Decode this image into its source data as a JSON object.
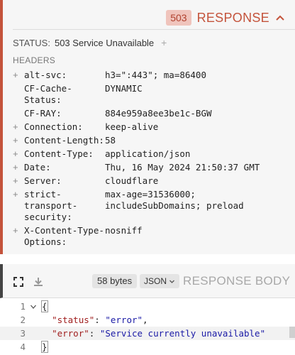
{
  "response": {
    "code": "503",
    "title": "RESPONSE",
    "status_label": "STATUS:",
    "status_value": "503 Service Unavailable",
    "headers_label": "HEADERS",
    "headers": [
      {
        "expandable": true,
        "name": "alt-svc:",
        "value": "h3=\":443\"; ma=86400"
      },
      {
        "expandable": false,
        "name": "CF-Cache-Status:",
        "value": "DYNAMIC"
      },
      {
        "expandable": false,
        "name": "CF-RAY:",
        "value": "884e959a8ee3be1c-BGW"
      },
      {
        "expandable": true,
        "name": "Connection:",
        "value": "keep-alive"
      },
      {
        "expandable": true,
        "name": "Content-Length:",
        "value": "58"
      },
      {
        "expandable": true,
        "name": "Content-Type:",
        "value": "application/json"
      },
      {
        "expandable": true,
        "name": "Date:",
        "value": "Thu, 16 May 2024 21:50:37 GMT"
      },
      {
        "expandable": true,
        "name": "Server:",
        "value": "cloudflare"
      },
      {
        "expandable": true,
        "name": "strict-transport-security:",
        "value": "max-age=31536000; includeSubDomains; preload"
      },
      {
        "expandable": true,
        "name": "X-Content-Type-Options:",
        "value": "nosniff"
      }
    ]
  },
  "body": {
    "size": "58 bytes",
    "format": "JSON",
    "title": "RESPONSE BODY",
    "lines": [
      {
        "num": "1",
        "text": "{"
      },
      {
        "num": "2",
        "key": "\"status\"",
        "value": "\"error\"",
        "trail": ","
      },
      {
        "num": "3",
        "key": "\"error\"",
        "value": "\"Service currently unavailable\"",
        "trail": ""
      },
      {
        "num": "4",
        "text": "}"
      }
    ]
  },
  "colors": {
    "accent": "#c4533b",
    "badge_bg": "#f0c4bc",
    "panel_bg": "#f6f6f6"
  },
  "icons": {
    "collapse": "chevron-up-icon",
    "expand_editor": "fullscreen-icon",
    "download": "download-icon",
    "add_header": "plus-icon",
    "fold": "chevron-down-icon"
  }
}
